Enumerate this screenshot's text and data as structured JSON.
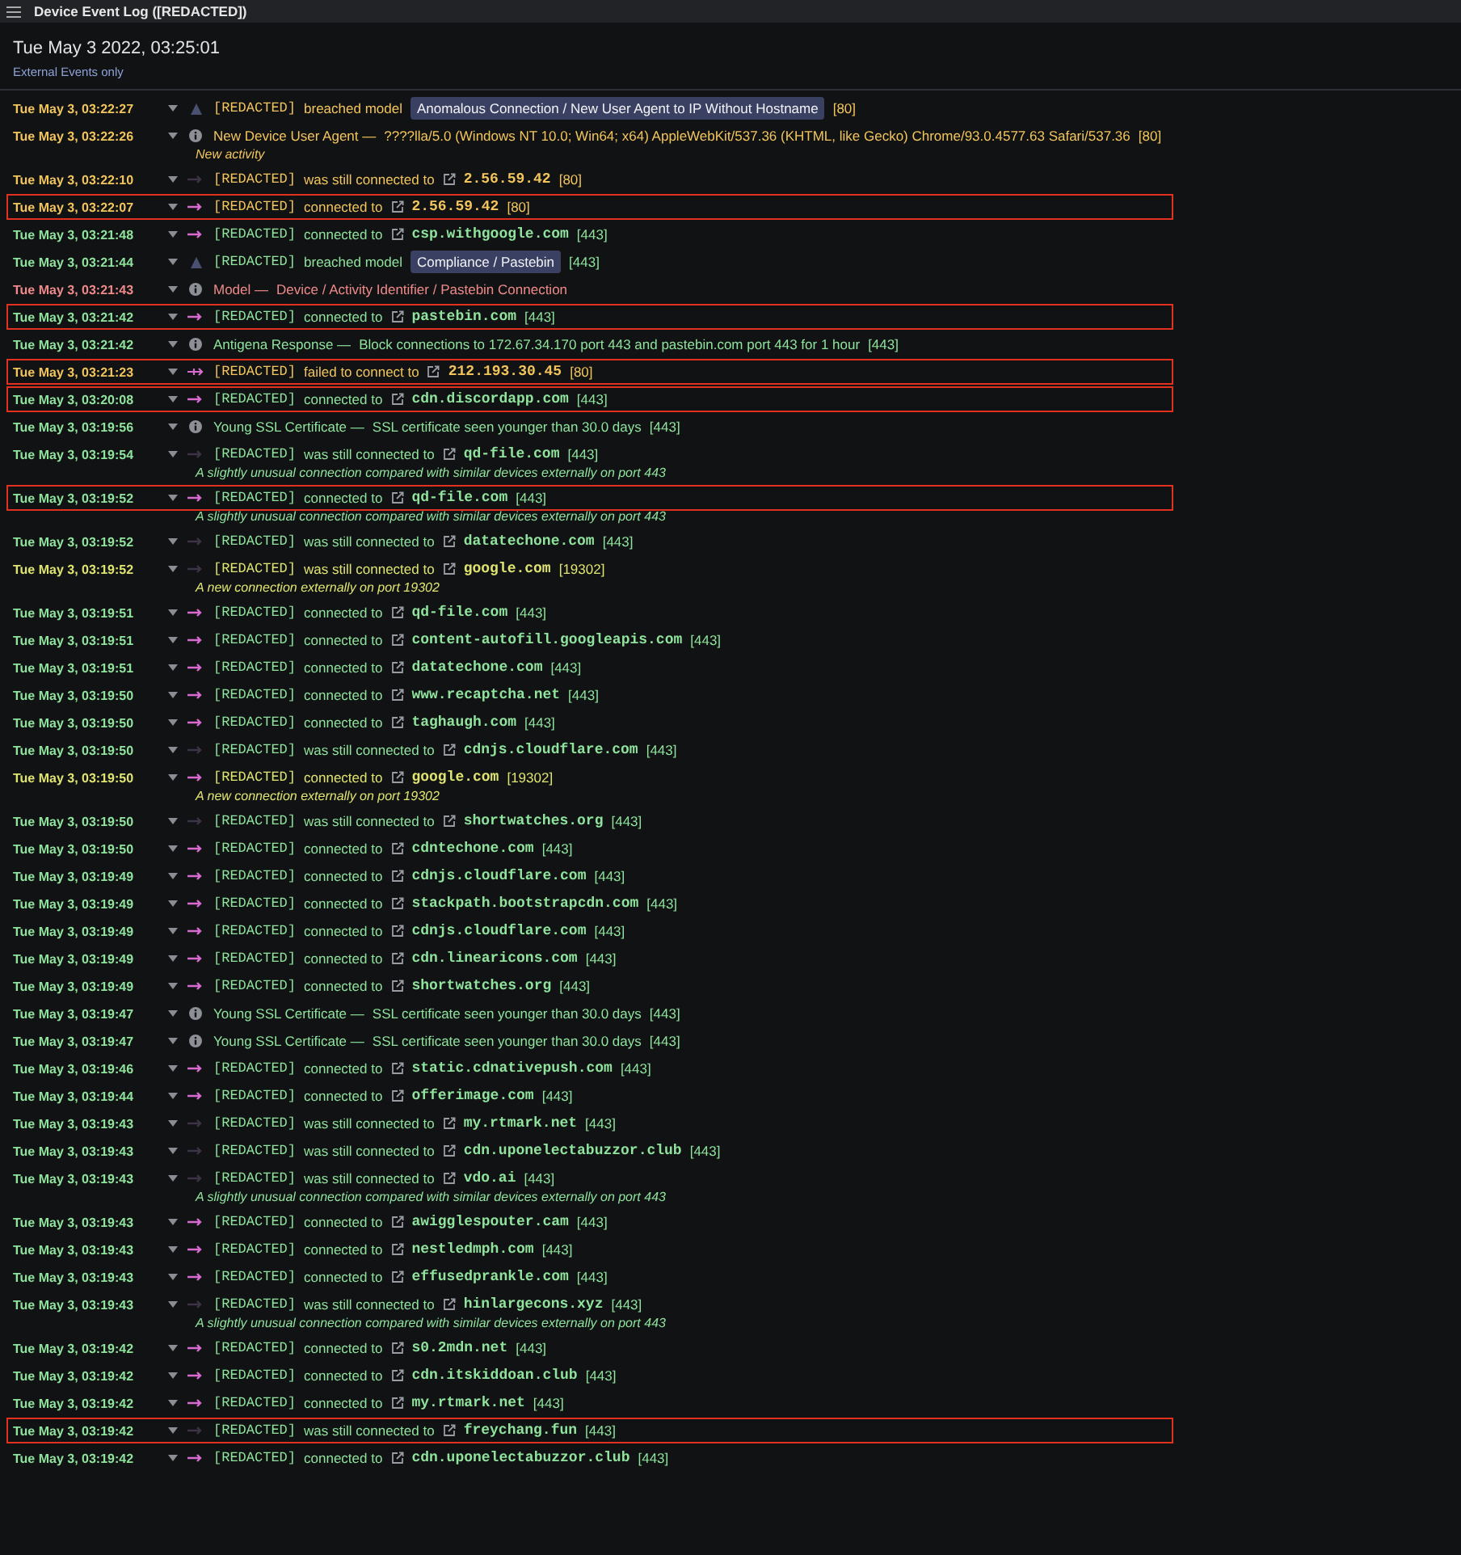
{
  "window": {
    "title": "Device Event Log ([REDACTED])"
  },
  "header": {
    "date": "Tue May 3 2022, 03:25:01",
    "filter": "External Events only"
  },
  "rows": [
    {
      "kind": "breach",
      "time": "Tue May 3, 03:22:27",
      "color": "#f2c55c",
      "highlighted": false,
      "device": "[REDACTED]",
      "verb": "breached model",
      "model": "Anomalous Connection / New User Agent to IP Without Hostname",
      "port": "[80]"
    },
    {
      "kind": "info",
      "time": "Tue May 3, 03:22:26",
      "color": "#f2c55c",
      "highlighted": false,
      "title": "New Device User Agent —",
      "detail": "????lla/5.0 (Windows NT 10.0; Win64; x64) AppleWebKit/537.36 (KHTML, like Gecko) Chrome/93.0.4577.63 Safari/537.36",
      "port": "[80]",
      "note": "New activity"
    },
    {
      "kind": "still",
      "time": "Tue May 3, 03:22:10",
      "color": "#f2c55c",
      "highlighted": false,
      "device": "[REDACTED]",
      "verb": "was still connected to",
      "host": "2.56.59.42",
      "port": "[80]"
    },
    {
      "kind": "connected",
      "time": "Tue May 3, 03:22:07",
      "color": "#f2c55c",
      "highlighted": true,
      "device": "[REDACTED]",
      "verb": "connected to",
      "host": "2.56.59.42",
      "port": "[80]"
    },
    {
      "kind": "connected",
      "time": "Tue May 3, 03:21:48",
      "color": "#8fe39c",
      "highlighted": false,
      "device": "[REDACTED]",
      "verb": "connected to",
      "host": "csp.withgoogle.com",
      "port": "[443]"
    },
    {
      "kind": "breach",
      "time": "Tue May 3, 03:21:44",
      "color": "#8fe39c",
      "highlighted": false,
      "device": "[REDACTED]",
      "verb": "breached model",
      "model": "Compliance / Pastebin",
      "port": "[443]"
    },
    {
      "kind": "info",
      "time": "Tue May 3, 03:21:43",
      "color": "#f08a8a",
      "highlighted": false,
      "title": "Model —",
      "detail": "Device / Activity Identifier / Pastebin Connection"
    },
    {
      "kind": "connected",
      "time": "Tue May 3, 03:21:42",
      "color": "#8fe39c",
      "highlighted": true,
      "device": "[REDACTED]",
      "verb": "connected to",
      "host": "pastebin.com",
      "port": "[443]"
    },
    {
      "kind": "info",
      "time": "Tue May 3, 03:21:42",
      "color": "#8fe39c",
      "highlighted": false,
      "title": "Antigena Response —",
      "detail": "Block connections to 172.67.34.170 port 443 and pastebin.com port 443 for 1 hour",
      "port": "[443]"
    },
    {
      "kind": "failed",
      "time": "Tue May 3, 03:21:23",
      "color": "#f2c55c",
      "highlighted": true,
      "device": "[REDACTED]",
      "verb": "failed to connect to",
      "host": "212.193.30.45",
      "port": "[80]"
    },
    {
      "kind": "connected",
      "time": "Tue May 3, 03:20:08",
      "color": "#8fe39c",
      "highlighted": true,
      "device": "[REDACTED]",
      "verb": "connected to",
      "host": "cdn.discordapp.com",
      "port": "[443]"
    },
    {
      "kind": "info",
      "time": "Tue May 3, 03:19:56",
      "color": "#8fe39c",
      "highlighted": false,
      "title": "Young SSL Certificate —",
      "detail": "SSL certificate seen younger than 30.0 days",
      "port": "[443]"
    },
    {
      "kind": "still",
      "time": "Tue May 3, 03:19:54",
      "color": "#8fe39c",
      "highlighted": false,
      "device": "[REDACTED]",
      "verb": "was still connected to",
      "host": "qd-file.com",
      "port": "[443]",
      "note": "A slightly unusual connection compared with similar devices externally on port 443"
    },
    {
      "kind": "connected",
      "time": "Tue May 3, 03:19:52",
      "color": "#8fe39c",
      "highlighted": true,
      "device": "[REDACTED]",
      "verb": "connected to",
      "host": "qd-file.com",
      "port": "[443]",
      "note": "A slightly unusual connection compared with similar devices externally on port 443"
    },
    {
      "kind": "still",
      "time": "Tue May 3, 03:19:52",
      "color": "#8fe39c",
      "highlighted": false,
      "device": "[REDACTED]",
      "verb": "was still connected to",
      "host": "datatechone.com",
      "port": "[443]"
    },
    {
      "kind": "still",
      "time": "Tue May 3, 03:19:52",
      "color": "#dfe470",
      "highlighted": false,
      "device": "[REDACTED]",
      "verb": "was still connected to",
      "host": "google.com",
      "port": "[19302]",
      "note": "A new connection externally on port 19302"
    },
    {
      "kind": "connected",
      "time": "Tue May 3, 03:19:51",
      "color": "#8fe39c",
      "highlighted": false,
      "device": "[REDACTED]",
      "verb": "connected to",
      "host": "qd-file.com",
      "port": "[443]"
    },
    {
      "kind": "connected",
      "time": "Tue May 3, 03:19:51",
      "color": "#8fe39c",
      "highlighted": false,
      "device": "[REDACTED]",
      "verb": "connected to",
      "host": "content-autofill.googleapis.com",
      "port": "[443]"
    },
    {
      "kind": "connected",
      "time": "Tue May 3, 03:19:51",
      "color": "#8fe39c",
      "highlighted": false,
      "device": "[REDACTED]",
      "verb": "connected to",
      "host": "datatechone.com",
      "port": "[443]"
    },
    {
      "kind": "connected",
      "time": "Tue May 3, 03:19:50",
      "color": "#8fe39c",
      "highlighted": false,
      "device": "[REDACTED]",
      "verb": "connected to",
      "host": "www.recaptcha.net",
      "port": "[443]"
    },
    {
      "kind": "connected",
      "time": "Tue May 3, 03:19:50",
      "color": "#8fe39c",
      "highlighted": false,
      "device": "[REDACTED]",
      "verb": "connected to",
      "host": "taghaugh.com",
      "port": "[443]"
    },
    {
      "kind": "still",
      "time": "Tue May 3, 03:19:50",
      "color": "#8fe39c",
      "highlighted": false,
      "device": "[REDACTED]",
      "verb": "was still connected to",
      "host": "cdnjs.cloudflare.com",
      "port": "[443]"
    },
    {
      "kind": "connected",
      "time": "Tue May 3, 03:19:50",
      "color": "#dfe470",
      "highlighted": false,
      "device": "[REDACTED]",
      "verb": "connected to",
      "host": "google.com",
      "port": "[19302]",
      "note": "A new connection externally on port 19302"
    },
    {
      "kind": "still",
      "time": "Tue May 3, 03:19:50",
      "color": "#8fe39c",
      "highlighted": false,
      "device": "[REDACTED]",
      "verb": "was still connected to",
      "host": "shortwatches.org",
      "port": "[443]"
    },
    {
      "kind": "connected",
      "time": "Tue May 3, 03:19:50",
      "color": "#8fe39c",
      "highlighted": false,
      "device": "[REDACTED]",
      "verb": "connected to",
      "host": "cdntechone.com",
      "port": "[443]"
    },
    {
      "kind": "connected",
      "time": "Tue May 3, 03:19:49",
      "color": "#8fe39c",
      "highlighted": false,
      "device": "[REDACTED]",
      "verb": "connected to",
      "host": "cdnjs.cloudflare.com",
      "port": "[443]"
    },
    {
      "kind": "connected",
      "time": "Tue May 3, 03:19:49",
      "color": "#8fe39c",
      "highlighted": false,
      "device": "[REDACTED]",
      "verb": "connected to",
      "host": "stackpath.bootstrapcdn.com",
      "port": "[443]"
    },
    {
      "kind": "connected",
      "time": "Tue May 3, 03:19:49",
      "color": "#8fe39c",
      "highlighted": false,
      "device": "[REDACTED]",
      "verb": "connected to",
      "host": "cdnjs.cloudflare.com",
      "port": "[443]"
    },
    {
      "kind": "connected",
      "time": "Tue May 3, 03:19:49",
      "color": "#8fe39c",
      "highlighted": false,
      "device": "[REDACTED]",
      "verb": "connected to",
      "host": "cdn.linearicons.com",
      "port": "[443]"
    },
    {
      "kind": "connected",
      "time": "Tue May 3, 03:19:49",
      "color": "#8fe39c",
      "highlighted": false,
      "device": "[REDACTED]",
      "verb": "connected to",
      "host": "shortwatches.org",
      "port": "[443]"
    },
    {
      "kind": "info",
      "time": "Tue May 3, 03:19:47",
      "color": "#8fe39c",
      "highlighted": false,
      "title": "Young SSL Certificate —",
      "detail": "SSL certificate seen younger than 30.0 days",
      "port": "[443]"
    },
    {
      "kind": "info",
      "time": "Tue May 3, 03:19:47",
      "color": "#8fe39c",
      "highlighted": false,
      "title": "Young SSL Certificate —",
      "detail": "SSL certificate seen younger than 30.0 days",
      "port": "[443]"
    },
    {
      "kind": "connected",
      "time": "Tue May 3, 03:19:46",
      "color": "#8fe39c",
      "highlighted": false,
      "device": "[REDACTED]",
      "verb": "connected to",
      "host": "static.cdnativepush.com",
      "port": "[443]"
    },
    {
      "kind": "connected",
      "time": "Tue May 3, 03:19:44",
      "color": "#8fe39c",
      "highlighted": false,
      "device": "[REDACTED]",
      "verb": "connected to",
      "host": "offerimage.com",
      "port": "[443]"
    },
    {
      "kind": "still",
      "time": "Tue May 3, 03:19:43",
      "color": "#8fe39c",
      "highlighted": false,
      "device": "[REDACTED]",
      "verb": "was still connected to",
      "host": "my.rtmark.net",
      "port": "[443]"
    },
    {
      "kind": "still",
      "time": "Tue May 3, 03:19:43",
      "color": "#8fe39c",
      "highlighted": false,
      "device": "[REDACTED]",
      "verb": "was still connected to",
      "host": "cdn.uponelectabuzzor.club",
      "port": "[443]"
    },
    {
      "kind": "still",
      "time": "Tue May 3, 03:19:43",
      "color": "#8fe39c",
      "highlighted": false,
      "device": "[REDACTED]",
      "verb": "was still connected to",
      "host": "vdo.ai",
      "port": "[443]",
      "note": "A slightly unusual connection compared with similar devices externally on port 443"
    },
    {
      "kind": "connected",
      "time": "Tue May 3, 03:19:43",
      "color": "#8fe39c",
      "highlighted": false,
      "device": "[REDACTED]",
      "verb": "connected to",
      "host": "awigglespouter.cam",
      "port": "[443]"
    },
    {
      "kind": "connected",
      "time": "Tue May 3, 03:19:43",
      "color": "#8fe39c",
      "highlighted": false,
      "device": "[REDACTED]",
      "verb": "connected to",
      "host": "nestledmph.com",
      "port": "[443]"
    },
    {
      "kind": "connected",
      "time": "Tue May 3, 03:19:43",
      "color": "#8fe39c",
      "highlighted": false,
      "device": "[REDACTED]",
      "verb": "connected to",
      "host": "effusedprankle.com",
      "port": "[443]"
    },
    {
      "kind": "still",
      "time": "Tue May 3, 03:19:43",
      "color": "#8fe39c",
      "highlighted": false,
      "device": "[REDACTED]",
      "verb": "was still connected to",
      "host": "hinlargecons.xyz",
      "port": "[443]",
      "note": "A slightly unusual connection compared with similar devices externally on port 443"
    },
    {
      "kind": "connected",
      "time": "Tue May 3, 03:19:42",
      "color": "#8fe39c",
      "highlighted": false,
      "device": "[REDACTED]",
      "verb": "connected to",
      "host": "s0.2mdn.net",
      "port": "[443]"
    },
    {
      "kind": "connected",
      "time": "Tue May 3, 03:19:42",
      "color": "#8fe39c",
      "highlighted": false,
      "device": "[REDACTED]",
      "verb": "connected to",
      "host": "cdn.itskiddoan.club",
      "port": "[443]"
    },
    {
      "kind": "connected",
      "time": "Tue May 3, 03:19:42",
      "color": "#8fe39c",
      "highlighted": false,
      "device": "[REDACTED]",
      "verb": "connected to",
      "host": "my.rtmark.net",
      "port": "[443]"
    },
    {
      "kind": "still",
      "time": "Tue May 3, 03:19:42",
      "color": "#8fe39c",
      "highlighted": true,
      "device": "[REDACTED]",
      "verb": "was still connected to",
      "host": "freychang.fun",
      "port": "[443]"
    },
    {
      "kind": "connected",
      "time": "Tue May 3, 03:19:42",
      "color": "#8fe39c",
      "highlighted": false,
      "device": "[REDACTED]",
      "verb": "connected to",
      "host": "cdn.uponelectabuzzor.club",
      "port": "[443]"
    }
  ]
}
